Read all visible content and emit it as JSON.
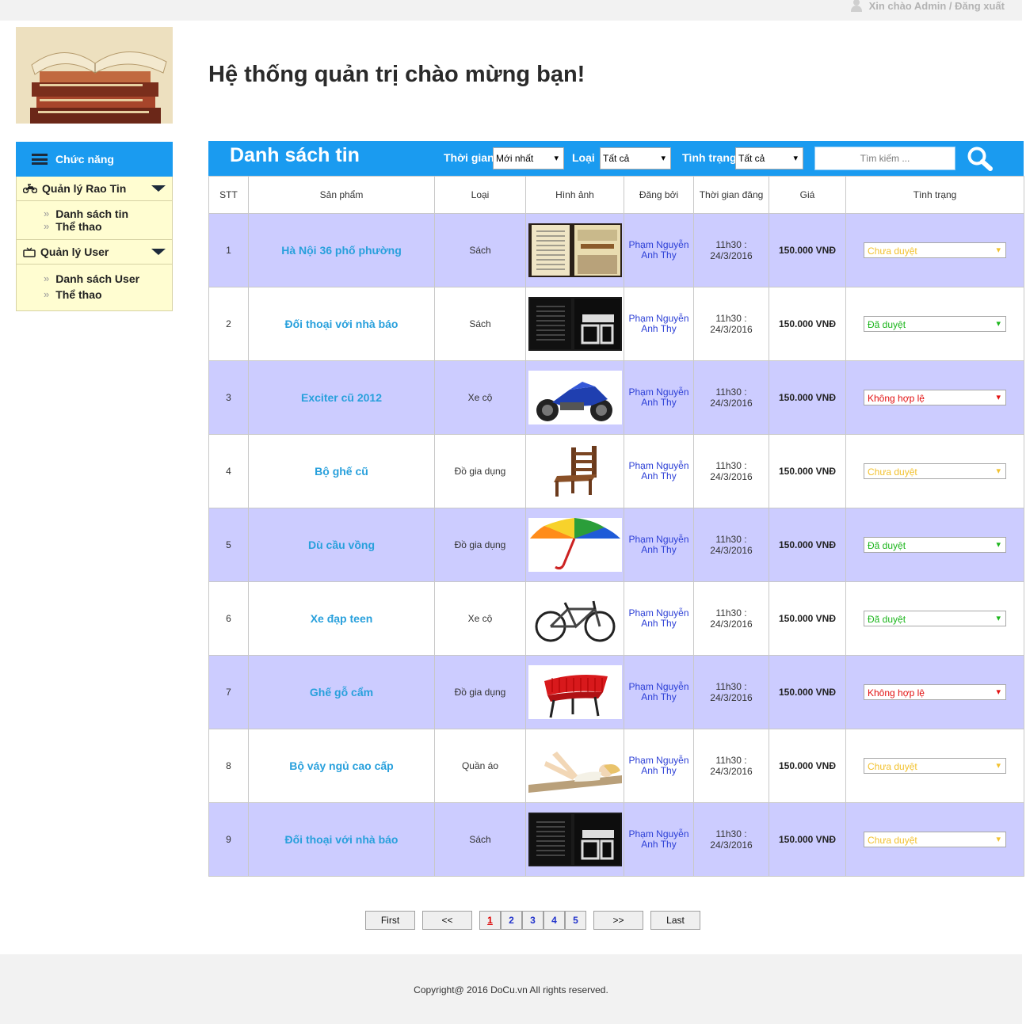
{
  "topbar": {
    "greeting": "Xin chào Admin / Đăng xuất"
  },
  "page_title": "Hệ thống quản trị chào mừng bạn!",
  "sidebar": {
    "header": "Chức năng",
    "sections": [
      {
        "title": "Quản lý Rao Tin",
        "icon": "motorbike-icon",
        "links": [
          "Danh sách tin",
          "Thể thao"
        ]
      },
      {
        "title": "Quản lý User",
        "icon": "tv-icon",
        "links": [
          "Danh sách User",
          "Thể thao"
        ]
      }
    ]
  },
  "list": {
    "title": "Danh sách tin",
    "filters": {
      "time_label": "Thời gian",
      "time_value": "Mới nhất",
      "type_label": "Loại",
      "type_value": "Tất cả",
      "status_label": "Tình trạng",
      "status_value": "Tất cả"
    },
    "search_placeholder": "Tìm kiếm ...",
    "columns": [
      "STT",
      "Sản phẩm",
      "Loại",
      "Hình ảnh",
      "Đăng bởi",
      "Thời gian đăng",
      "Giá",
      "Tình trạng"
    ],
    "rows": [
      {
        "stt": "1",
        "product": "Hà Nội 36 phố phường",
        "type": "Sách",
        "image": "book-hanoi",
        "poster": "Phạm Nguyễn Anh Thy",
        "time": "11h30 : 24/3/2016",
        "price": "150.000 VNĐ",
        "status": "Chưa duyệt",
        "status_kind": "pending"
      },
      {
        "stt": "2",
        "product": "Đối thoại với nhà báo",
        "type": "Sách",
        "image": "book-dark",
        "poster": "Phạm Nguyễn Anh Thy",
        "time": "11h30 : 24/3/2016",
        "price": "150.000 VNĐ",
        "status": "Đã duyệt",
        "status_kind": "ok"
      },
      {
        "stt": "3",
        "product": "Exciter cũ 2012",
        "type": "Xe cộ",
        "image": "motorbike",
        "poster": "Phạm Nguyễn Anh Thy",
        "time": "11h30 : 24/3/2016",
        "price": "150.000 VNĐ",
        "status": "Không hợp lệ",
        "status_kind": "bad"
      },
      {
        "stt": "4",
        "product": "Bộ ghế cũ",
        "type": "Đồ gia dụng",
        "image": "chair",
        "poster": "Phạm Nguyễn Anh Thy",
        "time": "11h30 : 24/3/2016",
        "price": "150.000 VNĐ",
        "status": "Chưa duyệt",
        "status_kind": "pending"
      },
      {
        "stt": "5",
        "product": "Dù cầu vồng",
        "type": "Đồ gia dụng",
        "image": "umbrella",
        "poster": "Phạm Nguyễn Anh Thy",
        "time": "11h30 : 24/3/2016",
        "price": "150.000 VNĐ",
        "status": "Đã duyệt",
        "status_kind": "ok"
      },
      {
        "stt": "6",
        "product": "Xe đạp teen",
        "type": "Xe cộ",
        "image": "bicycle",
        "poster": "Phạm Nguyễn Anh Thy",
        "time": "11h30 : 24/3/2016",
        "price": "150.000 VNĐ",
        "status": "Đã duyệt",
        "status_kind": "ok"
      },
      {
        "stt": "7",
        "product": "Ghế gỗ cẩm",
        "type": "Đồ gia dụng",
        "image": "red-chair",
        "poster": "Phạm Nguyễn Anh Thy",
        "time": "11h30 : 24/3/2016",
        "price": "150.000 VNĐ",
        "status": "Không hợp lệ",
        "status_kind": "bad"
      },
      {
        "stt": "8",
        "product": "Bộ váy ngủ cao cấp",
        "type": "Quần áo",
        "image": "sleepwear",
        "poster": "Phạm Nguyễn Anh Thy",
        "time": "11h30 : 24/3/2016",
        "price": "150.000 VNĐ",
        "status": "Chưa duyệt",
        "status_kind": "pending"
      },
      {
        "stt": "9",
        "product": "Đối thoại với nhà báo",
        "type": "Sách",
        "image": "book-dark",
        "poster": "Phạm Nguyễn Anh Thy",
        "time": "11h30 : 24/3/2016",
        "price": "150.000 VNĐ",
        "status": "Chưa duyệt",
        "status_kind": "pending"
      }
    ]
  },
  "pager": {
    "first": "First",
    "prev": "<<",
    "pages": [
      "1",
      "2",
      "3",
      "4",
      "5"
    ],
    "current": "1",
    "next": ">>",
    "last": "Last"
  },
  "footer": {
    "copyright": "Copyright@ 2016 DoCu.vn All rights reserved."
  },
  "colors": {
    "accent": "#1a9bf0",
    "row_alt": "#ccccff",
    "sidebar_bg": "#fffdd1",
    "pending": "#f2c12e",
    "ok": "#1bb51b",
    "bad": "#e21010"
  }
}
